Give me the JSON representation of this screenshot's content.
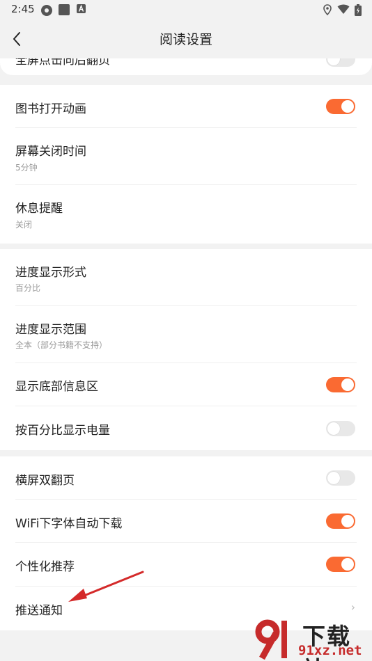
{
  "status_bar": {
    "time": "2:45"
  },
  "header": {
    "title": "阅读设置"
  },
  "rows": [
    {
      "title": "全屏点击向后翻页",
      "toggle": "off"
    },
    {
      "title": "图书打开动画",
      "toggle": "on"
    },
    {
      "title": "屏幕关闭时间",
      "subtitle": "5分钟"
    },
    {
      "title": "休息提醒",
      "subtitle": "关闭"
    },
    {
      "title": "进度显示形式",
      "subtitle": "百分比"
    },
    {
      "title": "进度显示范围",
      "subtitle": "全本（部分书籍不支持）"
    },
    {
      "title": "显示底部信息区",
      "toggle": "on"
    },
    {
      "title": "按百分比显示电量",
      "toggle": "off"
    },
    {
      "title": "横屏双翻页",
      "toggle": "off"
    },
    {
      "title": "WiFi下字体自动下载",
      "toggle": "on"
    },
    {
      "title": "个性化推荐",
      "toggle": "on"
    },
    {
      "title": "推送通知",
      "chevron": "›"
    }
  ],
  "watermark": {
    "line1": "下载站",
    "line2": "91xz.net"
  },
  "colors": {
    "accent": "#fa6a32",
    "background": "#f2f2f2",
    "card": "#ffffff",
    "arrow": "#d42a2a"
  }
}
